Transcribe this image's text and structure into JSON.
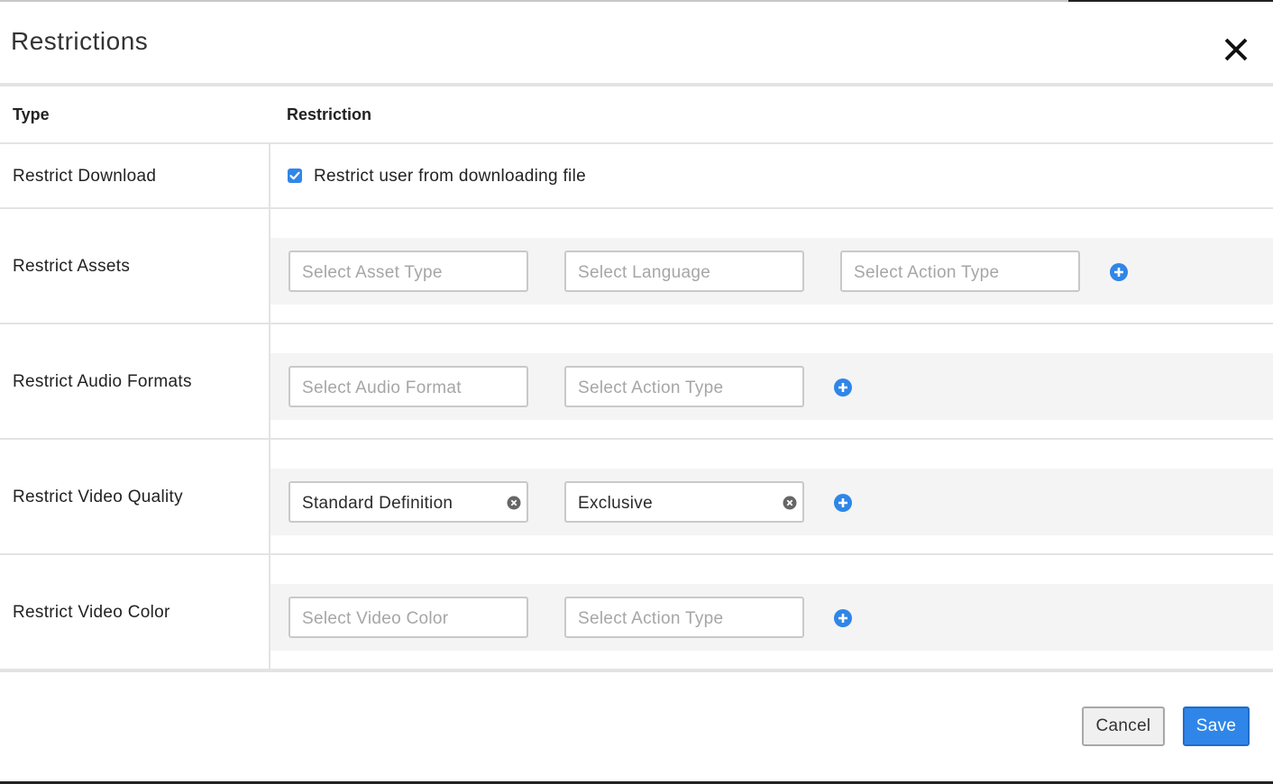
{
  "modal": {
    "title": "Restrictions"
  },
  "table": {
    "col_type": "Type",
    "col_restriction": "Restriction"
  },
  "rows": {
    "download": {
      "label": "Restrict Download",
      "checkbox_label": "Restrict user from downloading file",
      "checked": true
    },
    "assets": {
      "label": "Restrict Assets",
      "asset_type_placeholder": "Select Asset Type",
      "language_placeholder": "Select Language",
      "action_type_placeholder": "Select Action Type"
    },
    "audio": {
      "label": "Restrict Audio Formats",
      "format_placeholder": "Select Audio Format",
      "action_type_placeholder": "Select Action Type"
    },
    "video_quality": {
      "label": "Restrict Video Quality",
      "quality_value": "Standard Definition",
      "action_type_value": "Exclusive"
    },
    "video_color": {
      "label": "Restrict Video Color",
      "color_placeholder": "Select Video Color",
      "action_type_placeholder": "Select Action Type"
    }
  },
  "footer": {
    "cancel_label": "Cancel",
    "save_label": "Save"
  },
  "icons": {
    "close": "close-icon",
    "add": "plus-circle-icon",
    "clear": "x-circle-icon",
    "check": "checkbox-checked-icon"
  },
  "colors": {
    "accent": "#2f86e8",
    "placeholder": "#a6a6a6",
    "band": "#f4f4f4"
  }
}
